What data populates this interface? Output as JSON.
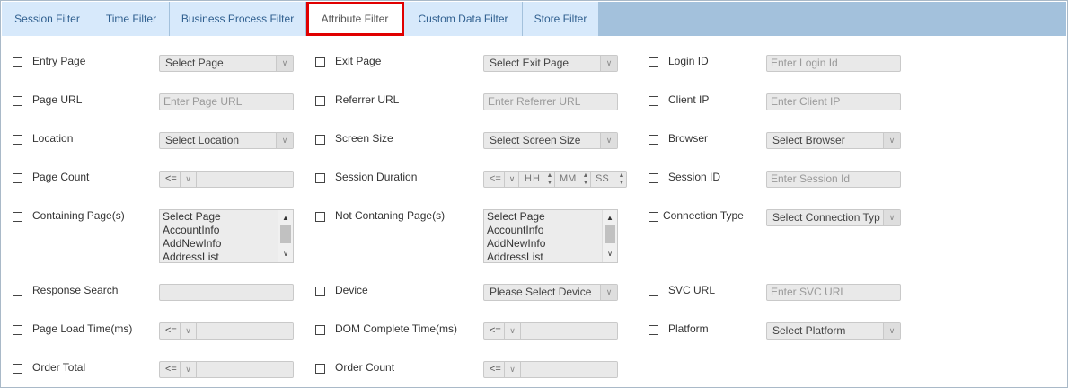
{
  "tabs": [
    {
      "label": "Session Filter"
    },
    {
      "label": "Time Filter"
    },
    {
      "label": "Business Process Filter"
    },
    {
      "label": "Attribute Filter"
    },
    {
      "label": "Custom Data Filter"
    },
    {
      "label": "Store Filter"
    }
  ],
  "active_tab": "Attribute Filter",
  "col1": {
    "entry_page": {
      "label": "Entry Page",
      "value": "Select Page"
    },
    "page_url": {
      "label": "Page URL",
      "placeholder": "Enter Page URL"
    },
    "location": {
      "label": "Location",
      "value": "Select Location"
    },
    "page_count": {
      "label": "Page Count",
      "op": "<="
    },
    "containing_pages": {
      "label": "Containing Page(s)",
      "options": [
        "Select Page",
        "AccountInfo",
        "AddNewInfo",
        "AddressList"
      ]
    },
    "response_search": {
      "label": "Response Search"
    },
    "page_load_time": {
      "label": "Page Load Time(ms)",
      "op": "<="
    },
    "order_total": {
      "label": "Order Total",
      "op": "<="
    }
  },
  "col2": {
    "exit_page": {
      "label": "Exit Page",
      "value": "Select Exit Page"
    },
    "referrer_url": {
      "label": "Referrer URL",
      "placeholder": "Enter Referrer URL"
    },
    "screen_size": {
      "label": "Screen Size",
      "value": "Select Screen Size"
    },
    "session_duration": {
      "label": "Session Duration",
      "op": "<=",
      "hh": "HH",
      "mm": "MM",
      "ss": "SS"
    },
    "not_containing_pages": {
      "label": "Not Contaning Page(s)",
      "options": [
        "Select Page",
        "AccountInfo",
        "AddNewInfo",
        "AddressList"
      ]
    },
    "device": {
      "label": "Device",
      "value": "Please Select Device"
    },
    "dom_complete_time": {
      "label": "DOM Complete Time(ms)",
      "op": "<="
    },
    "order_count": {
      "label": "Order Count",
      "op": "<="
    }
  },
  "col3": {
    "login_id": {
      "label": "Login ID",
      "placeholder": "Enter Login Id"
    },
    "client_ip": {
      "label": "Client IP",
      "placeholder": "Enter Client IP"
    },
    "browser": {
      "label": "Browser",
      "value": "Select Browser"
    },
    "session_id": {
      "label": "Session ID",
      "placeholder": "Enter Session Id"
    },
    "connection_type": {
      "label": "Connection Type",
      "value": "Select Connection Typ"
    },
    "svc_url": {
      "label": "SVC URL",
      "placeholder": "Enter SVC URL"
    },
    "platform": {
      "label": "Platform",
      "value": "Select Platform"
    }
  },
  "icons": {
    "dropdown": "chevron-down-icon",
    "spinner": "spinner-arrows-icon",
    "scroll": "scroll-arrow-icon"
  }
}
